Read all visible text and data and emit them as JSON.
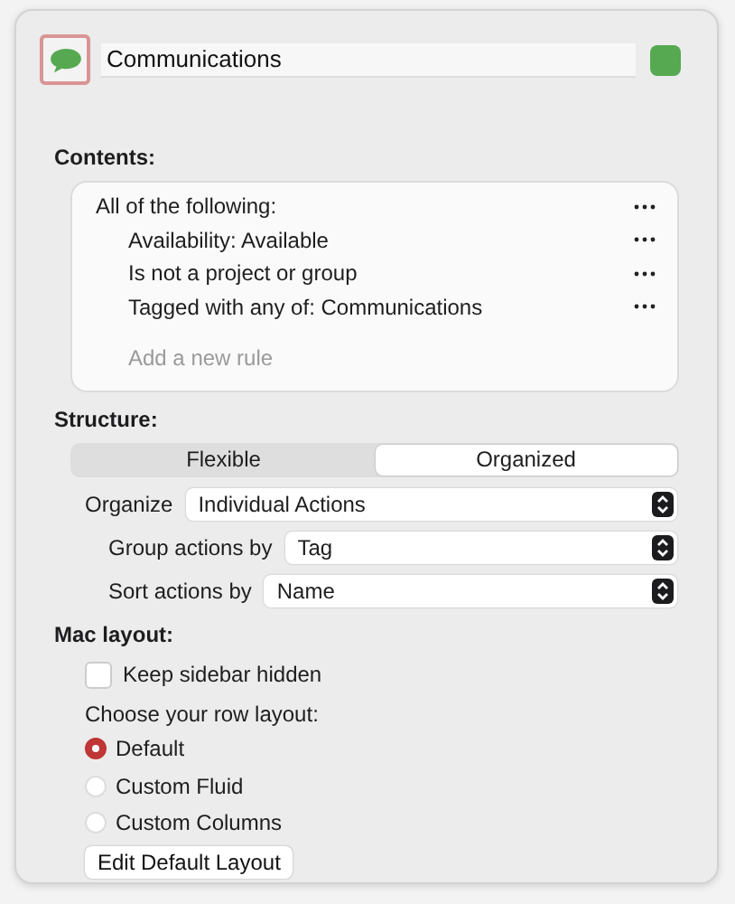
{
  "header": {
    "name": "Communications",
    "color": "#56a951"
  },
  "contents": {
    "label": "Contents:",
    "root": "All of the following:",
    "rules": [
      {
        "text": "Availability: Available"
      },
      {
        "text": "Is not a project or group"
      },
      {
        "text": "Tagged with any of: Communications"
      }
    ],
    "add_placeholder": "Add a new rule"
  },
  "structure": {
    "label": "Structure:",
    "segments": [
      {
        "label": "Flexible",
        "selected": false
      },
      {
        "label": "Organized",
        "selected": true
      }
    ],
    "popups": [
      {
        "label": "Organize",
        "value": "Individual Actions",
        "indent": false
      },
      {
        "label": "Group actions by",
        "value": "Tag",
        "indent": true
      },
      {
        "label": "Sort actions by",
        "value": "Name",
        "indent": true
      }
    ]
  },
  "mac_layout": {
    "label": "Mac layout:",
    "checkbox": {
      "label": "Keep sidebar hidden",
      "checked": false
    },
    "row_layout_label": "Choose your row layout:",
    "radios": [
      {
        "label": "Default",
        "selected": true
      },
      {
        "label": "Custom Fluid",
        "selected": false
      },
      {
        "label": "Custom Columns",
        "selected": false
      }
    ],
    "button": "Edit Default Layout"
  }
}
